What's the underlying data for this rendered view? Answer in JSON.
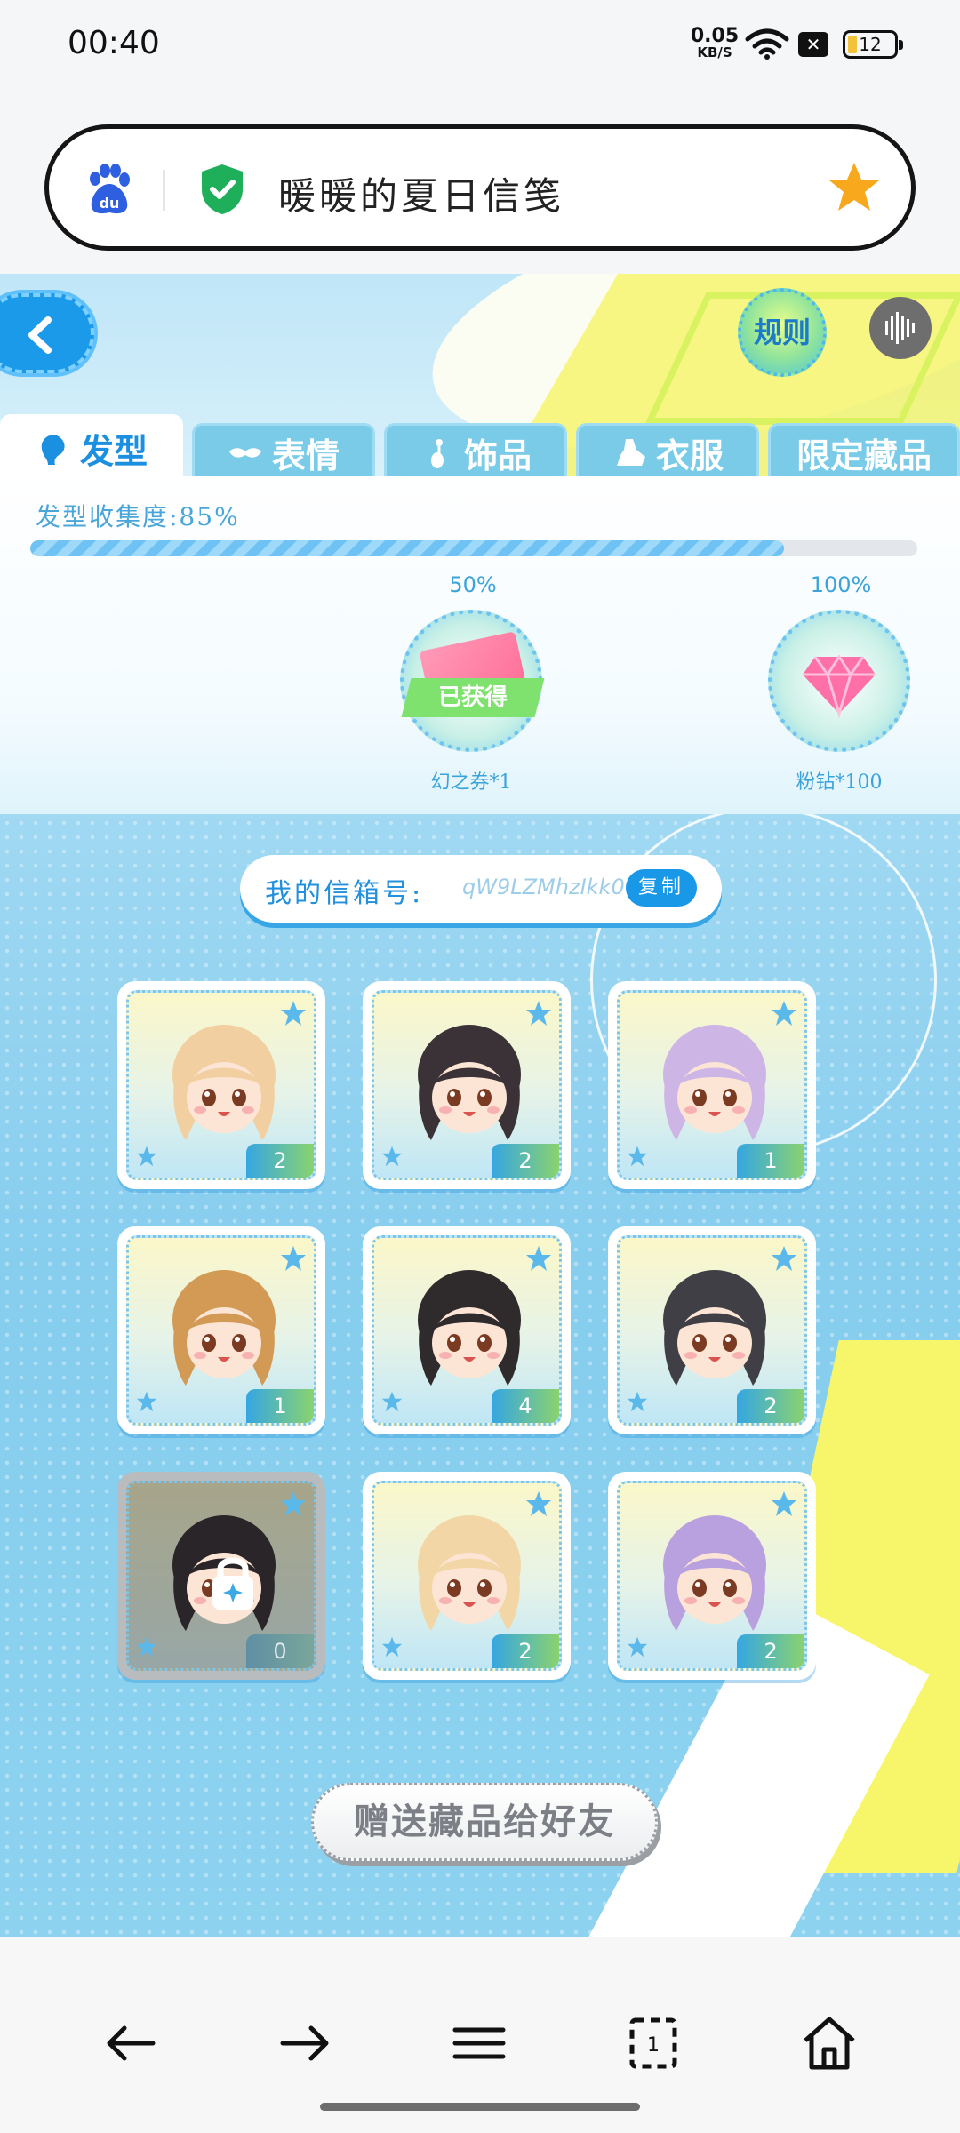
{
  "status_bar": {
    "time": "00:40",
    "net_speed_value": "0.05",
    "net_speed_unit": "KB/S",
    "sim_label": "✕",
    "battery": "12"
  },
  "address_bar": {
    "title": "暖暖的夏日信笺",
    "icons": [
      "baidu-icon",
      "shield-check-icon",
      "star-icon"
    ]
  },
  "header": {
    "rules_label": "规则"
  },
  "tabs": [
    {
      "label": "发型",
      "icon": "hair-icon",
      "active": true
    },
    {
      "label": "表情",
      "icon": "mask-icon",
      "active": false
    },
    {
      "label": "饰品",
      "icon": "earring-icon",
      "active": false
    },
    {
      "label": "衣服",
      "icon": "clothes-icon",
      "active": false
    },
    {
      "label": "限定藏品",
      "icon": "",
      "active": false
    }
  ],
  "collection": {
    "label": "发型收集度:85%",
    "progress_fraction": 0.85,
    "milestones": [
      {
        "percent": "50%",
        "name": "幻之券*1",
        "status": "已获得"
      },
      {
        "percent": "100%",
        "name": "粉钻*100",
        "status": ""
      }
    ]
  },
  "mailbox": {
    "label": "我的信箱号:",
    "id": "qW9LZMhzIkk0",
    "copy_label": "复制"
  },
  "items": [
    {
      "count": "2",
      "hair": "#f2cfa0",
      "locked": false
    },
    {
      "count": "2",
      "hair": "#3a3236",
      "locked": false
    },
    {
      "count": "1",
      "hair": "#cdb6e6",
      "locked": false
    },
    {
      "count": "1",
      "hair": "#d39a55",
      "locked": false
    },
    {
      "count": "4",
      "hair": "#2f2a2c",
      "locked": false
    },
    {
      "count": "2",
      "hair": "#3f3f45",
      "locked": false
    },
    {
      "count": "0",
      "hair": "#2a2528",
      "locked": true
    },
    {
      "count": "2",
      "hair": "#f3d6a6",
      "locked": false
    },
    {
      "count": "2",
      "hair": "#b9a0df",
      "locked": false
    }
  ],
  "gift_button_label": "赠送藏品给好友",
  "bottom_nav": [
    "back-arrow-icon",
    "forward-arrow-icon",
    "menu-icon",
    "tabs-icon",
    "home-icon"
  ],
  "bottom_nav_tab_count": "1",
  "colors": {
    "accent": "#1b8fe0",
    "progress": "#6fc3f4",
    "copy_button": "#1898e6"
  }
}
